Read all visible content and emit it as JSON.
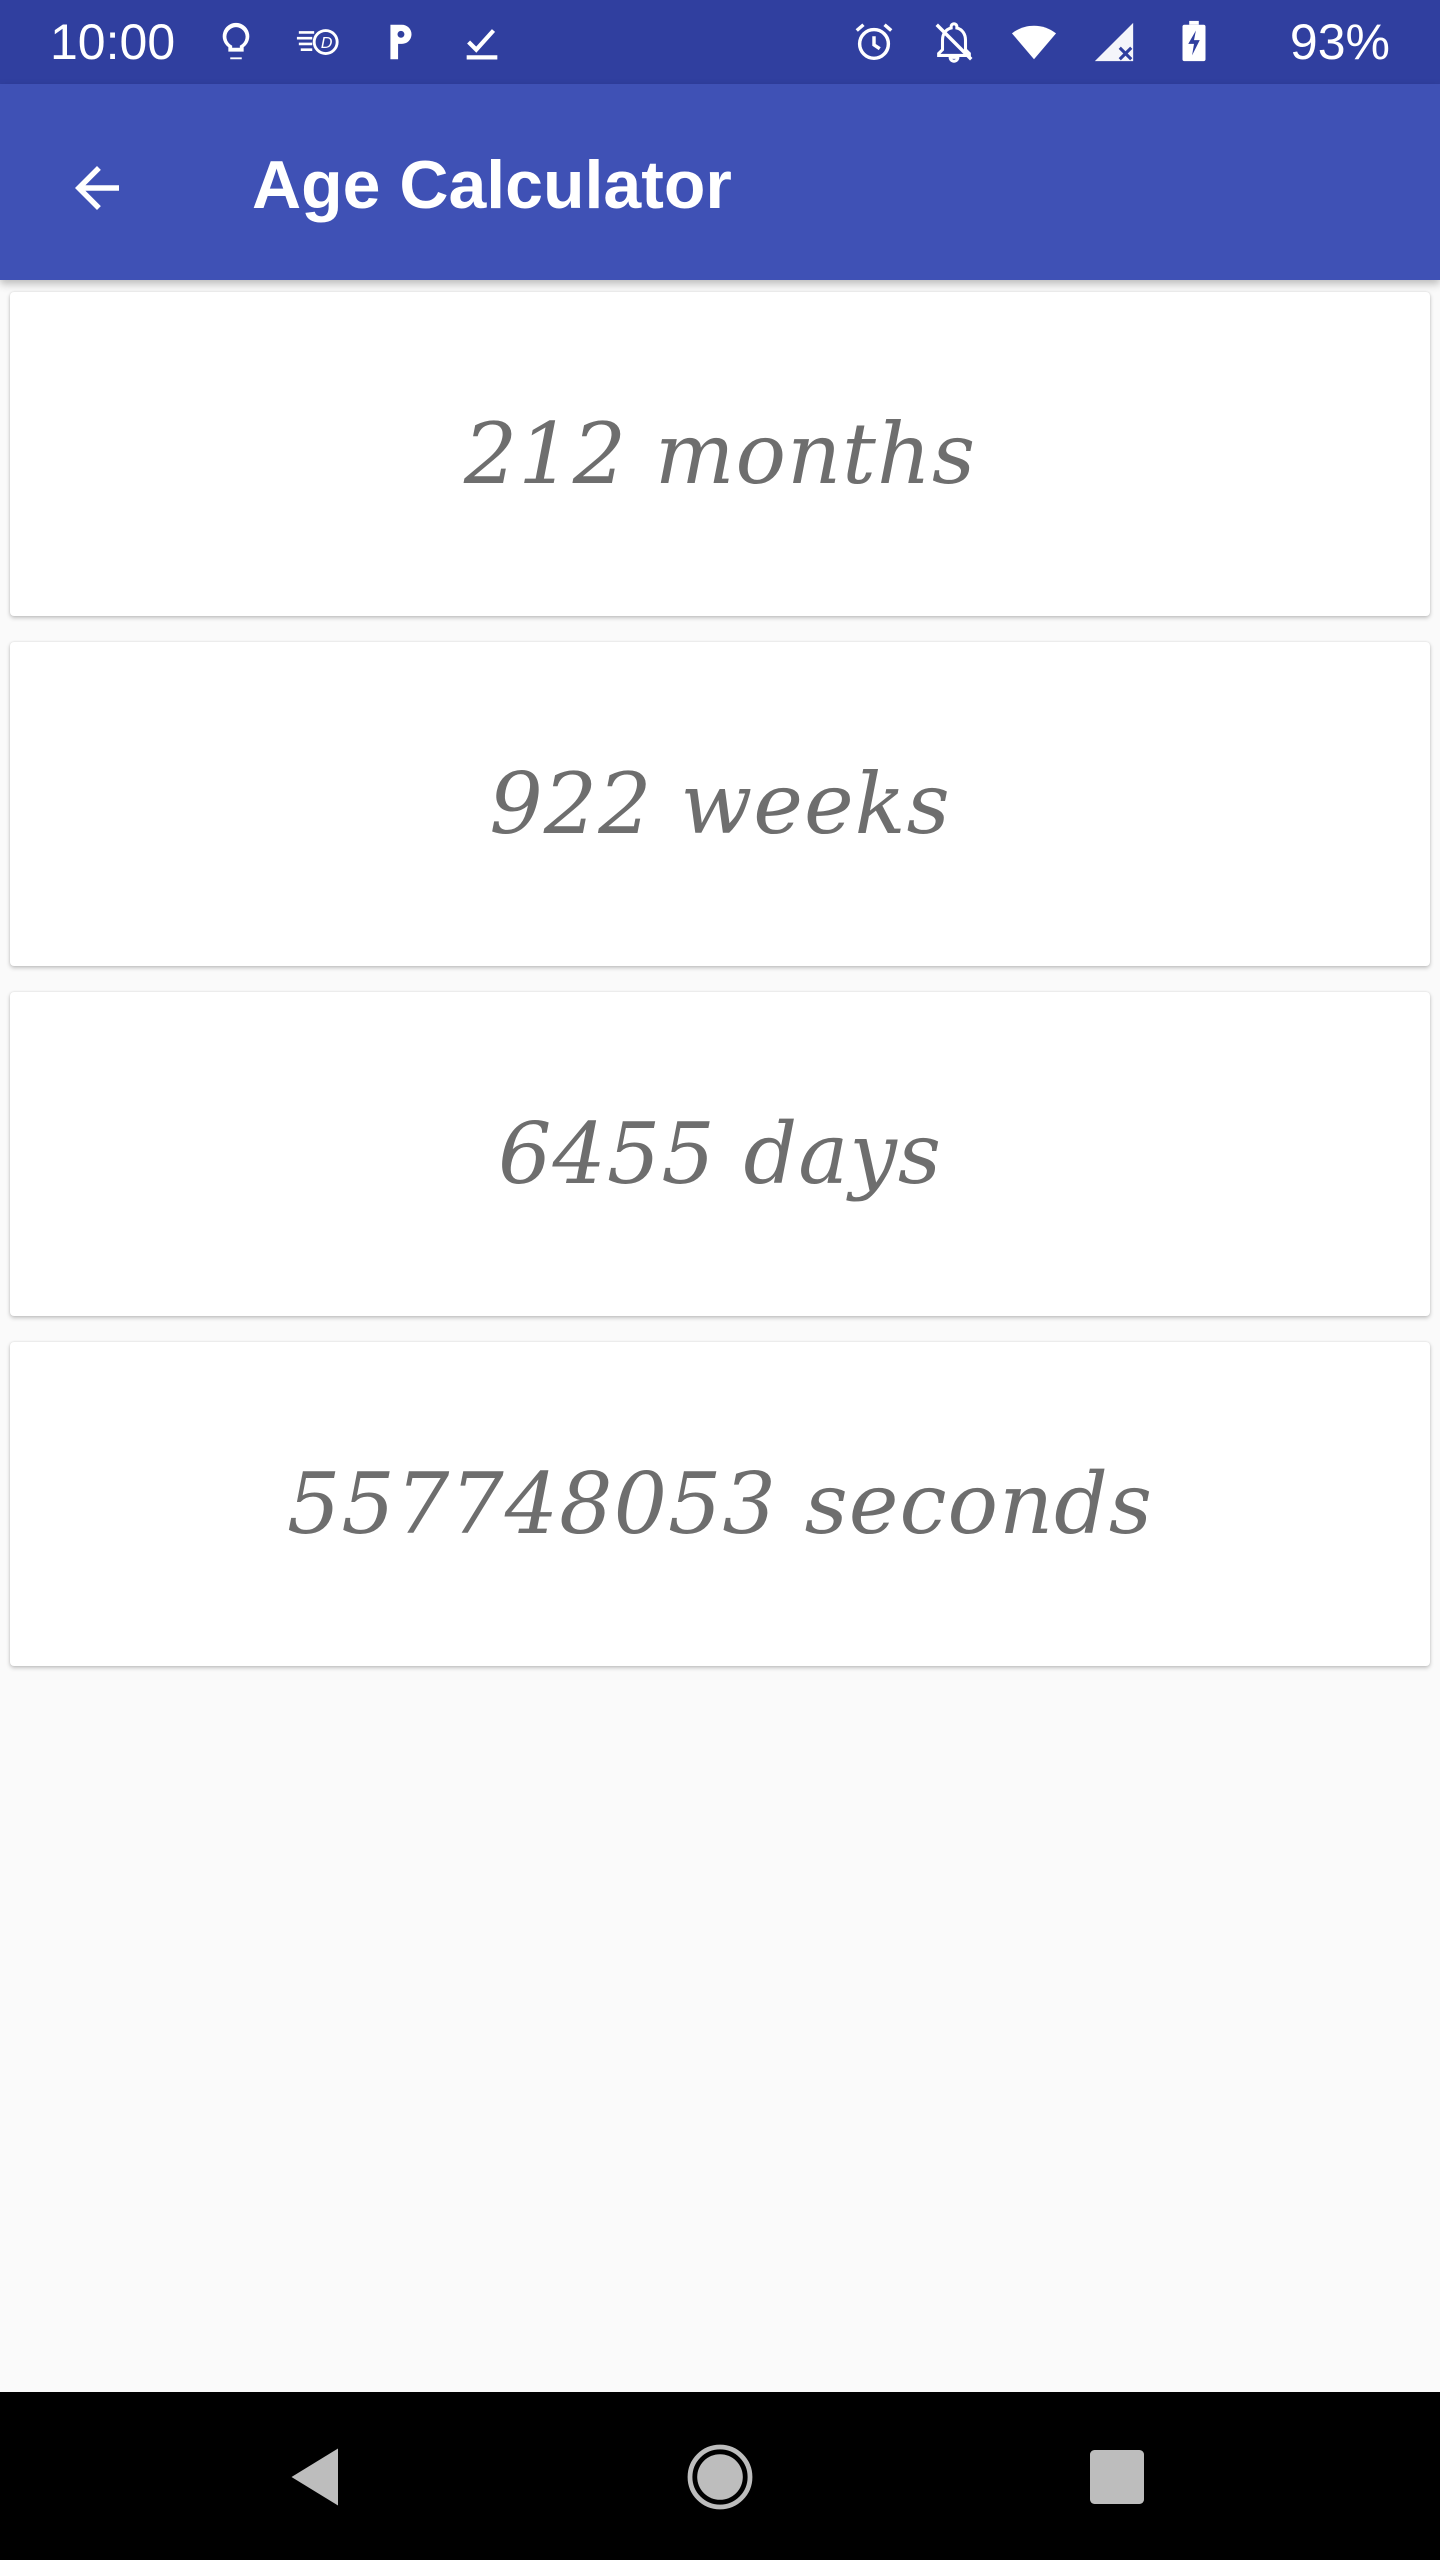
{
  "status_bar": {
    "time": "10:00",
    "battery_percent": "93%",
    "left_icons": [
      "lightbulb-icon",
      "speed-d-icon",
      "p-icon",
      "check-download-icon"
    ],
    "right_icons": [
      "alarm-icon",
      "notifications-off-icon",
      "wifi-icon",
      "signal-icon",
      "battery-charging-icon"
    ],
    "background": "#303f9f"
  },
  "app_bar": {
    "title": "Age Calculator",
    "back_icon": "arrow-back-icon",
    "background": "#3f51b5"
  },
  "results": [
    {
      "text": "212 months"
    },
    {
      "text": "922 weeks"
    },
    {
      "text": "6455 days"
    },
    {
      "text": "557748053 seconds"
    }
  ],
  "nav_bar": {
    "buttons": [
      "back-triangle-icon",
      "home-circle-icon",
      "recents-square-icon"
    ]
  }
}
